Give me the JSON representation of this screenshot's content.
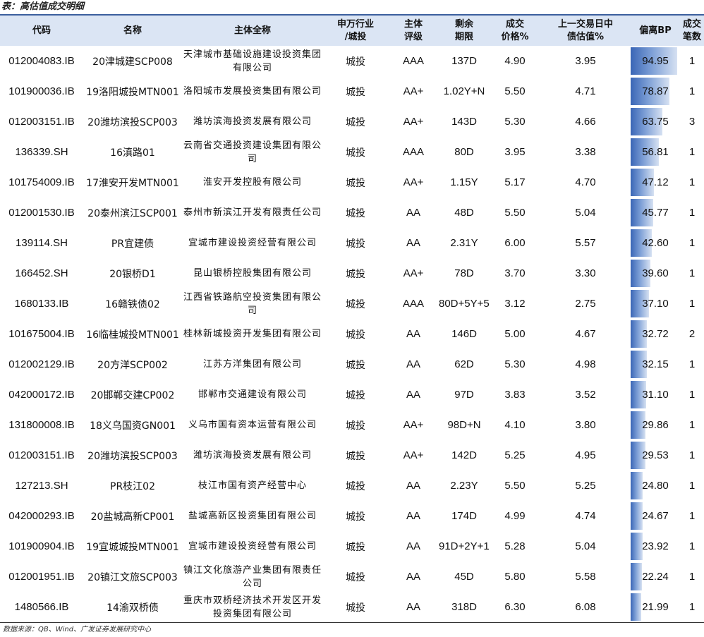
{
  "caption": "表：高估值成交明细",
  "headers": {
    "code": "代码",
    "name": "名称",
    "issuer": "主体全称",
    "industry_1": "申万行业",
    "industry_2": "/城投",
    "rating_1": "主体",
    "rating_2": "评级",
    "tenor_1": "剩余",
    "tenor_2": "期限",
    "price_1": "成交",
    "price_2": "价格%",
    "valuation_1": "上一交易日中",
    "valuation_2": "债估值%",
    "bp": "偏离BP",
    "count_1": "成交",
    "count_2": "笔数"
  },
  "rows": [
    {
      "code": "012004083.IB",
      "name": "20津城建SCP008",
      "issuer": "天津城市基础设施建设投资集团有限公司",
      "industry": "城投",
      "rating": "AAA",
      "tenor": "137D",
      "price": "4.90",
      "valuation": "3.95",
      "bp": "94.95",
      "count": "1"
    },
    {
      "code": "101900036.IB",
      "name": "19洛阳城投MTN001",
      "issuer": "洛阳城市发展投资集团有限公司",
      "industry": "城投",
      "rating": "AA+",
      "tenor": "1.02Y+N",
      "price": "5.50",
      "valuation": "4.71",
      "bp": "78.87",
      "count": "1"
    },
    {
      "code": "012003151.IB",
      "name": "20潍坊滨投SCP003",
      "issuer": "潍坊滨海投资发展有限公司",
      "industry": "城投",
      "rating": "AA+",
      "tenor": "143D",
      "price": "5.30",
      "valuation": "4.66",
      "bp": "63.75",
      "count": "3"
    },
    {
      "code": "136339.SH",
      "name": "16滇路01",
      "issuer": "云南省交通投资建设集团有限公司",
      "industry": "城投",
      "rating": "AAA",
      "tenor": "80D",
      "price": "3.95",
      "valuation": "3.38",
      "bp": "56.81",
      "count": "1"
    },
    {
      "code": "101754009.IB",
      "name": "17淮安开发MTN001",
      "issuer": "淮安开发控股有限公司",
      "industry": "城投",
      "rating": "AA+",
      "tenor": "1.15Y",
      "price": "5.17",
      "valuation": "4.70",
      "bp": "47.12",
      "count": "1"
    },
    {
      "code": "012001530.IB",
      "name": "20泰州滨江SCP001",
      "issuer": "泰州市新滨江开发有限责任公司",
      "industry": "城投",
      "rating": "AA",
      "tenor": "48D",
      "price": "5.50",
      "valuation": "5.04",
      "bp": "45.77",
      "count": "1"
    },
    {
      "code": "139114.SH",
      "name": "PR宜建债",
      "issuer": "宜城市建设投资经营有限公司",
      "industry": "城投",
      "rating": "AA",
      "tenor": "2.31Y",
      "price": "6.00",
      "valuation": "5.57",
      "bp": "42.60",
      "count": "1"
    },
    {
      "code": "166452.SH",
      "name": "20银桥D1",
      "issuer": "昆山银桥控股集团有限公司",
      "industry": "城投",
      "rating": "AA+",
      "tenor": "78D",
      "price": "3.70",
      "valuation": "3.30",
      "bp": "39.60",
      "count": "1"
    },
    {
      "code": "1680133.IB",
      "name": "16赣铁债02",
      "issuer": "江西省铁路航空投资集团有限公司",
      "industry": "城投",
      "rating": "AAA",
      "tenor": "80D+5Y+5Y",
      "price": "3.12",
      "valuation": "2.75",
      "bp": "37.10",
      "count": "1"
    },
    {
      "code": "101675004.IB",
      "name": "16临桂城投MTN001",
      "issuer": "桂林新城投资开发集团有限公司",
      "industry": "城投",
      "rating": "AA",
      "tenor": "146D",
      "price": "5.00",
      "valuation": "4.67",
      "bp": "32.72",
      "count": "2"
    },
    {
      "code": "012002129.IB",
      "name": "20方洋SCP002",
      "issuer": "江苏方洋集团有限公司",
      "industry": "城投",
      "rating": "AA",
      "tenor": "62D",
      "price": "5.30",
      "valuation": "4.98",
      "bp": "32.15",
      "count": "1"
    },
    {
      "code": "042000172.IB",
      "name": "20邯郸交建CP002",
      "issuer": "邯郸市交通建设有限公司",
      "industry": "城投",
      "rating": "AA",
      "tenor": "97D",
      "price": "3.83",
      "valuation": "3.52",
      "bp": "31.10",
      "count": "1"
    },
    {
      "code": "131800008.IB",
      "name": "18义乌国资GN001",
      "issuer": "义乌市国有资本运营有限公司",
      "industry": "城投",
      "rating": "AA+",
      "tenor": "98D+N",
      "price": "4.10",
      "valuation": "3.80",
      "bp": "29.86",
      "count": "1"
    },
    {
      "code": "012003151.IB",
      "name": "20潍坊滨投SCP003",
      "issuer": "潍坊滨海投资发展有限公司",
      "industry": "城投",
      "rating": "AA+",
      "tenor": "142D",
      "price": "5.25",
      "valuation": "4.95",
      "bp": "29.53",
      "count": "1"
    },
    {
      "code": "127213.SH",
      "name": "PR枝江02",
      "issuer": "枝江市国有资产经营中心",
      "industry": "城投",
      "rating": "AA",
      "tenor": "2.23Y",
      "price": "5.50",
      "valuation": "5.25",
      "bp": "24.80",
      "count": "1"
    },
    {
      "code": "042000293.IB",
      "name": "20盐城高新CP001",
      "issuer": "盐城高新区投资集团有限公司",
      "industry": "城投",
      "rating": "AA",
      "tenor": "174D",
      "price": "4.99",
      "valuation": "4.74",
      "bp": "24.67",
      "count": "1"
    },
    {
      "code": "101900904.IB",
      "name": "19宜城城投MTN001",
      "issuer": "宜城市建设投资经营有限公司",
      "industry": "城投",
      "rating": "AA",
      "tenor": "91D+2Y+1Y",
      "price": "5.28",
      "valuation": "5.04",
      "bp": "23.92",
      "count": "1"
    },
    {
      "code": "012001951.IB",
      "name": "20镇江文旅SCP003",
      "issuer": "镇江文化旅游产业集团有限责任公司",
      "industry": "城投",
      "rating": "AA",
      "tenor": "45D",
      "price": "5.80",
      "valuation": "5.58",
      "bp": "22.24",
      "count": "1"
    },
    {
      "code": "1480566.IB",
      "name": "14渝双桥债",
      "issuer": "重庆市双桥经济技术开发区开发投资集团有限公司",
      "industry": "城投",
      "rating": "AA",
      "tenor": "318D",
      "price": "6.30",
      "valuation": "6.08",
      "bp": "21.99",
      "count": "1"
    }
  ],
  "bp_max": 100,
  "bar_color": "#3a66b6",
  "header_bg": "#dbe5f4",
  "footnote": "数据来源：QB、Wind、广发证券发展研究中心"
}
